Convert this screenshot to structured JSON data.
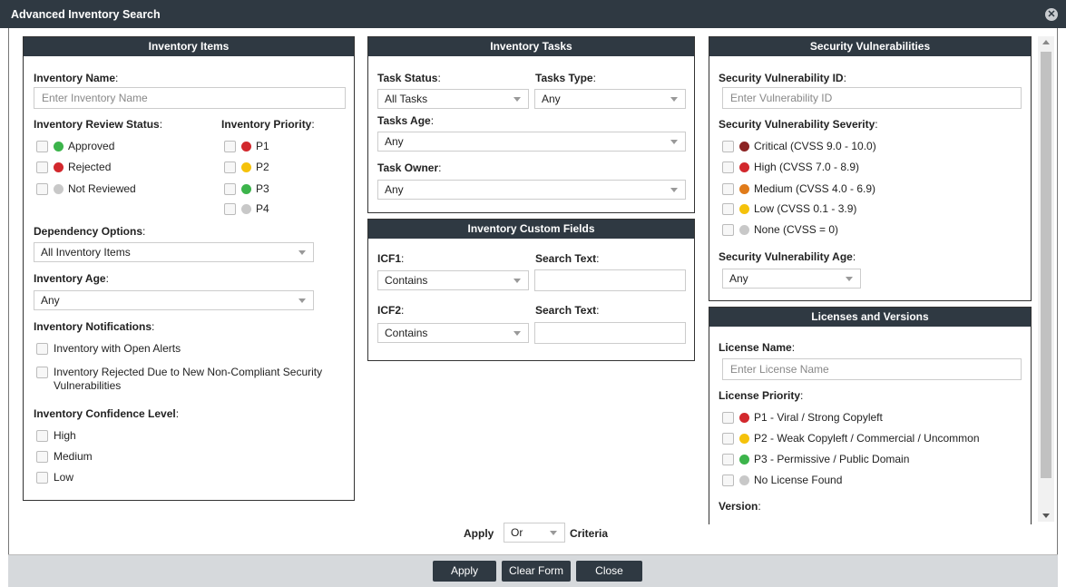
{
  "window": {
    "title": "Advanced Inventory Search"
  },
  "colors": {
    "header": "#2f3942",
    "green": "#3cb44b",
    "red": "#d2282d",
    "gray": "#c8c8c8",
    "yellow": "#f5c20b",
    "darkred": "#8b2323",
    "orange": "#e07b1a"
  },
  "inventory_items": {
    "title": "Inventory Items",
    "name_label": "Inventory Name",
    "name_placeholder": "Enter Inventory Name",
    "review_status_label": "Inventory Review Status",
    "review_status": [
      "Approved",
      "Rejected",
      "Not Reviewed"
    ],
    "priority_label": "Inventory Priority",
    "priorities": [
      "P1",
      "P2",
      "P3",
      "P4"
    ],
    "dependency_label": "Dependency Options",
    "dependency_value": "All Inventory Items",
    "age_label": "Inventory Age",
    "age_value": "Any",
    "notifications_label": "Inventory Notifications",
    "notifications": [
      "Inventory with Open Alerts",
      "Inventory Rejected Due to New Non-Compliant Security Vulnerabilities"
    ],
    "confidence_label": "Inventory Confidence Level",
    "confidence": [
      "High",
      "Medium",
      "Low"
    ]
  },
  "inventory_tasks": {
    "title": "Inventory Tasks",
    "status_label": "Task Status",
    "status_value": "All Tasks",
    "type_label": "Tasks Type",
    "type_value": "Any",
    "age_label": "Tasks Age",
    "age_value": "Any",
    "owner_label": "Task Owner",
    "owner_value": "Any"
  },
  "custom_fields": {
    "title": "Inventory Custom Fields",
    "icf1_label": "ICF1",
    "icf1_value": "Contains",
    "icf2_label": "ICF2",
    "icf2_value": "Contains",
    "search_label": "Search Text"
  },
  "security": {
    "title": "Security Vulnerabilities",
    "id_label": "Security Vulnerability ID",
    "id_placeholder": "Enter Vulnerability ID",
    "severity_label": "Security Vulnerability Severity",
    "severities": [
      "Critical (CVSS 9.0 - 10.0)",
      "High (CVSS 7.0 - 8.9)",
      "Medium (CVSS 4.0 - 6.9)",
      "Low (CVSS 0.1 - 3.9)",
      "None (CVSS = 0)"
    ],
    "age_label": "Security Vulnerability Age",
    "age_value": "Any"
  },
  "licenses": {
    "title": "Licenses and Versions",
    "name_label": "License Name",
    "name_placeholder": "Enter License Name",
    "priority_label": "License Priority",
    "priorities": [
      "P1 - Viral / Strong Copyleft",
      "P2 - Weak Copyleft / Commercial / Uncommon",
      "P3 - Permissive / Public Domain",
      "No License Found"
    ],
    "version_label": "Version"
  },
  "criteria": {
    "apply_label": "Apply",
    "operator_value": "Or",
    "criteria_label": "Criteria"
  },
  "buttons": {
    "apply": "Apply",
    "clear": "Clear Form",
    "close": "Close"
  },
  "colon": ":"
}
